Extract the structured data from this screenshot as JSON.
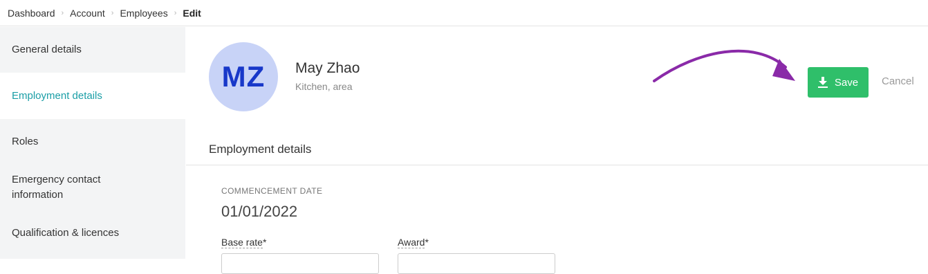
{
  "breadcrumb": {
    "items": [
      "Dashboard",
      "Account",
      "Employees"
    ],
    "current": "Edit"
  },
  "sidebar": {
    "items": [
      {
        "label": "General details"
      },
      {
        "label": "Employment details",
        "active": true
      },
      {
        "label": "Roles"
      },
      {
        "label": "Emergency contact information"
      },
      {
        "label": "Qualification & licences"
      }
    ]
  },
  "profile": {
    "initials": "MZ",
    "name": "May Zhao",
    "subtitle": "Kitchen, area"
  },
  "actions": {
    "save_label": "Save",
    "cancel_label": "Cancel"
  },
  "section": {
    "title": "Employment details",
    "commencement_label": "COMMENCEMENT DATE",
    "commencement_value": "01/01/2022",
    "base_rate_label": "Base rate",
    "award_label": "Award",
    "required_marker": "*"
  },
  "colors": {
    "accent_teal": "#1a9ea6",
    "save_green": "#2fbf6a",
    "avatar_bg": "#c8d3f7",
    "avatar_text": "#1838c9",
    "annotation_purple": "#8a2aa8"
  },
  "icons": {
    "save": "download-icon",
    "separator": "chevron-right-icon",
    "annotation": "curved-arrow-icon"
  }
}
